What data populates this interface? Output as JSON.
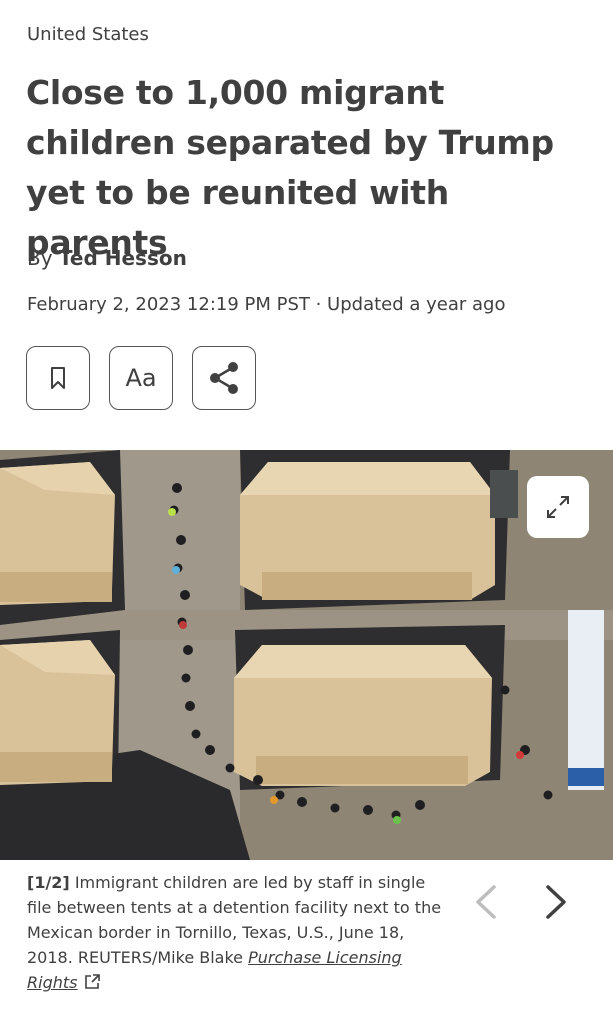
{
  "section": "United States",
  "headline": "Close to 1,000 migrant children separated by Trump yet to be reunited with parents",
  "byline": {
    "prefix": "By",
    "author": "Ted Hesson"
  },
  "dateline": "February 2, 2023 12:19 PM PST · Updated a year ago",
  "tools": {
    "bookmark_icon": "bookmark-icon",
    "text_size_label": "Aa",
    "share_icon": "share-icon"
  },
  "photo": {
    "expand_icon": "expand-icon"
  },
  "caption": {
    "index": "[1/2]",
    "text": "Immigrant children are led by staff in single file between tents at a detention facility next to the Mexican border in Tornillo, Texas, U.S., June 18, 2018. REUTERS/Mike Blake",
    "link_label": "Purchase Licensing Rights"
  },
  "gallery_nav": {
    "prev_icon": "chevron-left-icon",
    "next_icon": "chevron-right-icon"
  },
  "colors": {
    "text": "#404040",
    "nav_disabled": "#bdbdbd",
    "nav_active": "#404040"
  }
}
